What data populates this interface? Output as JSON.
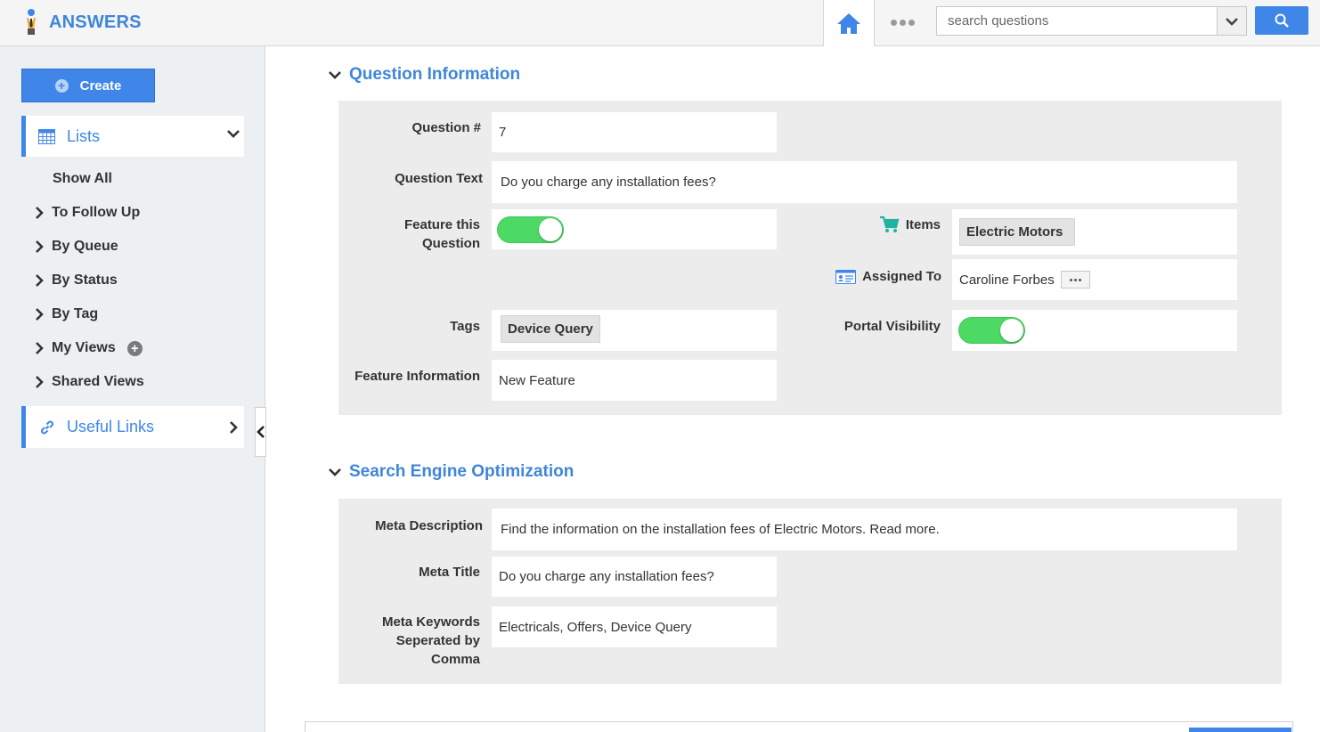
{
  "app": {
    "title": "ANSWERS"
  },
  "header": {
    "search_placeholder": "search questions"
  },
  "sidebar": {
    "create_label": "Create",
    "lists_label": "Lists",
    "items": [
      {
        "label": "Show All",
        "arrow": false
      },
      {
        "label": "To Follow Up",
        "arrow": true
      },
      {
        "label": "By Queue",
        "arrow": true
      },
      {
        "label": "By Status",
        "arrow": true
      },
      {
        "label": "By Tag",
        "arrow": true
      },
      {
        "label": "My Views",
        "arrow": true
      },
      {
        "label": "Shared Views",
        "arrow": true
      }
    ],
    "useful_links_label": "Useful Links"
  },
  "question_info": {
    "section_title": "Question Information",
    "question_number": {
      "label": "Question #",
      "value": "7"
    },
    "question_text": {
      "label": "Question Text",
      "value": "Do you charge any installation fees?"
    },
    "feature_question": {
      "label_line1": "Feature this",
      "label_line2": "Question",
      "on": true
    },
    "items": {
      "label": "Items",
      "value": "Electric Motors"
    },
    "assigned_to": {
      "label": "Assigned To",
      "value": "Caroline Forbes"
    },
    "tags": {
      "label": "Tags",
      "value": "Device Query"
    },
    "portal_visibility": {
      "label": "Portal Visibility",
      "on": true
    },
    "feature_information": {
      "label": "Feature Information",
      "value": "New Feature"
    }
  },
  "seo": {
    "section_title": "Search Engine Optimization",
    "meta_description": {
      "label": "Meta Description",
      "value": "Find the information on the installation fees of Electric Motors. Read more."
    },
    "meta_title": {
      "label": "Meta Title",
      "value": "Do you charge any installation fees?"
    },
    "meta_keywords": {
      "label_line1": "Meta Keywords",
      "label_line2": "Seperated by",
      "label_line3": "Comma",
      "value": "Electricals, Offers, Device Query"
    }
  },
  "colors": {
    "accent": "#3f86e8",
    "toggle_on": "#4cd964",
    "sidebar_bg": "#edf0f3"
  },
  "icons": [
    "person-logo-icon",
    "home-icon",
    "more-dots-icon",
    "chevron-down-icon",
    "search-icon",
    "plus-circle-icon",
    "calendar-grid-icon",
    "chevron-right-icon",
    "link-icon",
    "chevron-left-icon",
    "cart-icon",
    "id-card-icon"
  ]
}
